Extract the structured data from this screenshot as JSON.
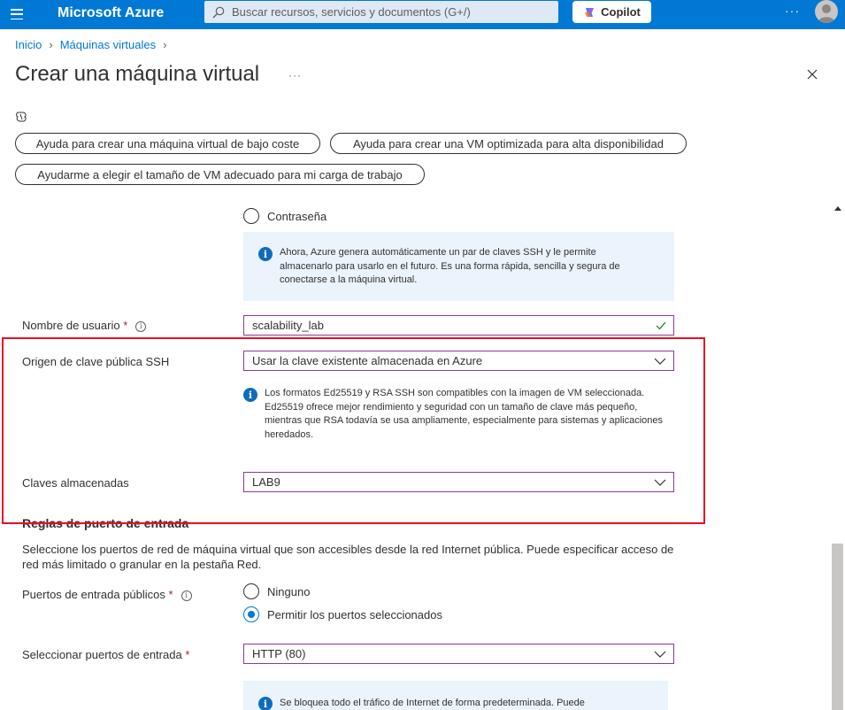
{
  "topbar": {
    "brand": "Microsoft Azure",
    "search_placeholder": "Buscar recursos, servicios y documentos (G+/)",
    "copilot_label": "Copilot",
    "more": "···"
  },
  "breadcrumb": {
    "items": [
      "Inicio",
      "Máquinas virtuales"
    ]
  },
  "page": {
    "title": "Crear una máquina virtual",
    "more": "···"
  },
  "prompts": {
    "p1": "Ayuda para crear una máquina virtual de bajo coste",
    "p2": "Ayuda para crear una VM optimizada para alta disponibilidad",
    "p3": "Ayudarme a elegir el tamaño de VM adecuado para mi carga de trabajo"
  },
  "auth": {
    "password_label": "Contraseña",
    "info": "Ahora, Azure genera automáticamente un par de claves SSH y le permite almacenarlo para usarlo en el futuro. Es una forma rápida, sencilla y segura de conectarse a la máquina virtual."
  },
  "username": {
    "label": "Nombre de usuario",
    "required": "*",
    "value": "scalability_lab"
  },
  "ssh_source": {
    "label": "Origen de clave pública SSH",
    "value": "Usar la clave existente almacenada en Azure",
    "info": "Los formatos Ed25519 y RSA SSH son compatibles con la imagen de VM seleccionada. Ed25519 ofrece mejor rendimiento y seguridad con un tamaño de clave más pequeño, mientras que RSA todavía se usa ampliamente, especialmente para sistemas y aplicaciones heredados."
  },
  "stored_keys": {
    "label": "Claves almacenadas",
    "value": "LAB9"
  },
  "inbound": {
    "heading": "Reglas de puerto de entrada",
    "description": "Seleccione los puertos de red de máquina virtual que son accesibles desde la red Internet pública. Puede especificar acceso de red más limitado o granular en la pestaña Red.",
    "public_ports_label": "Puertos de entrada públicos",
    "required": "*",
    "option_none": "Ninguno",
    "option_allow": "Permitir los puertos seleccionados",
    "select_label": "Seleccionar puertos de entrada",
    "select_value": "HTTP (80)",
    "info": "Se bloquea todo el tráfico de Internet de forma predeterminada. Puede"
  },
  "colors": {
    "azure_blue": "#0078d4",
    "highlight_red": "#e81123",
    "info_bg": "#ebf3fc"
  }
}
